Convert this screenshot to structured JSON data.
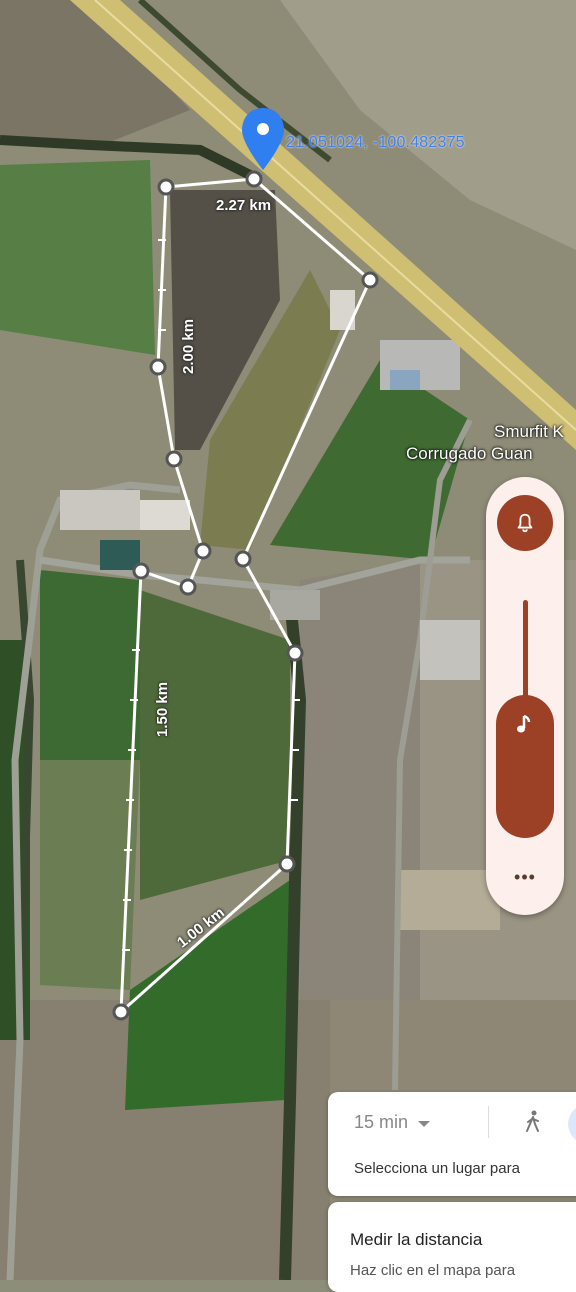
{
  "map": {
    "coordinates": "21.051024, -100.482375",
    "place_label_line1": "Smurfit K",
    "place_label_line2": "Corrugado Guan",
    "distances": [
      "2.27 km",
      "2.00 km",
      "1.50 km",
      "1.00 km"
    ],
    "colors": {
      "road": "#cdbd72",
      "field_green": "#4d7a3c",
      "route": "#ffffff",
      "pin": "#2f7ff1"
    }
  },
  "volume_panel": {
    "bell_icon": "bell-icon",
    "music_icon": "music-note-icon",
    "more_label": "•••",
    "accent_color": "#9c4125"
  },
  "bottom_cards": {
    "time_select": "15 min",
    "walk_icon": "walk-icon",
    "select_place_text": "Selecciona un lugar para",
    "measure_title": "Medir la distancia",
    "measure_hint": "Haz clic en el mapa para"
  }
}
